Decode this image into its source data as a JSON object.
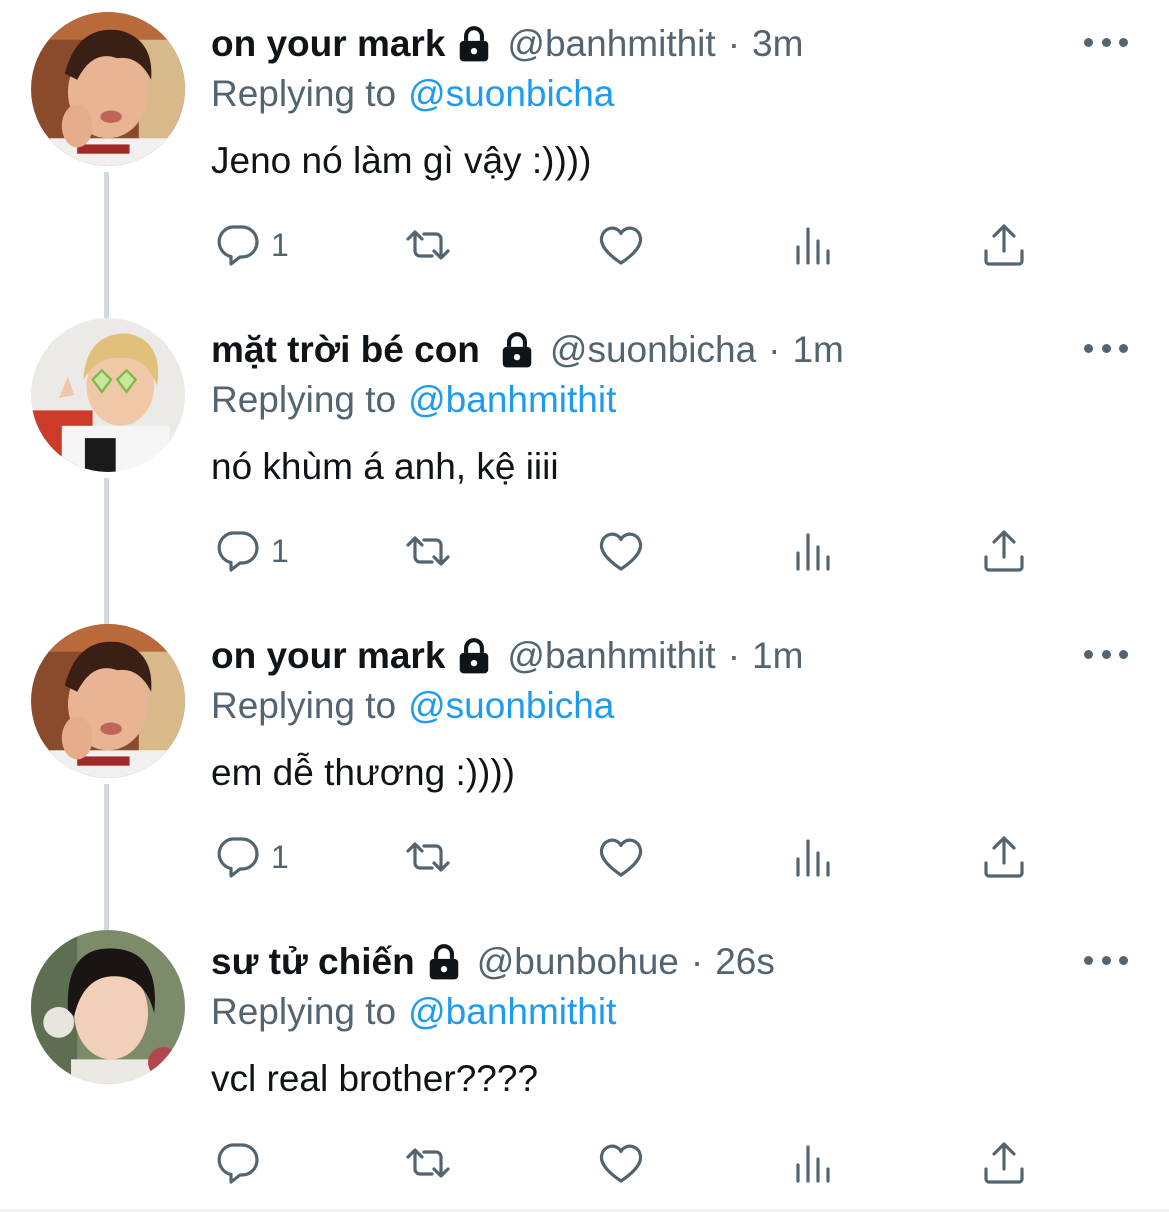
{
  "tweets": [
    {
      "name": "on your mark",
      "handle": "@banhmithit",
      "dot": "·",
      "time": "3m",
      "replying_label": "Replying to",
      "replying_to": "@suonbicha",
      "text": "Jeno nó làm gì vậy :))))",
      "reply_count": "1",
      "avatar": "avatar-photo-boy-pout"
    },
    {
      "name": "mặt trời bé con",
      "handle": "@suonbicha",
      "dot": "·",
      "time": "1m",
      "replying_label": "Replying to",
      "replying_to": "@banhmithit",
      "text": "nó khùm á anh, kệ iiii",
      "reply_count": "1",
      "avatar": "avatar-photo-blonde-heart-glasses"
    },
    {
      "name": "on your mark",
      "handle": "@banhmithit",
      "dot": "·",
      "time": "1m",
      "replying_label": "Replying to",
      "replying_to": "@suonbicha",
      "text": "em dễ thương :))))",
      "reply_count": "1",
      "avatar": "avatar-photo-boy-pout"
    },
    {
      "name": "sư tử chiến",
      "handle": "@bunbohue",
      "dot": "·",
      "time": "26s",
      "replying_label": "Replying to",
      "replying_to": "@banhmithit",
      "text": "vcl real brother????",
      "reply_count": "",
      "avatar": "avatar-photo-dark-hair"
    }
  ],
  "icons": {
    "lock": "lock-icon",
    "more": "more-horizontal-icon",
    "reply": "reply-bubble-icon",
    "retweet": "retweet-icon",
    "like": "heart-icon",
    "stats": "analytics-bars-icon",
    "share": "share-upload-icon"
  },
  "colors": {
    "text": "#0f1419",
    "secondary": "#536471",
    "link": "#1d9bf0",
    "thread_line": "#cfd9de"
  }
}
